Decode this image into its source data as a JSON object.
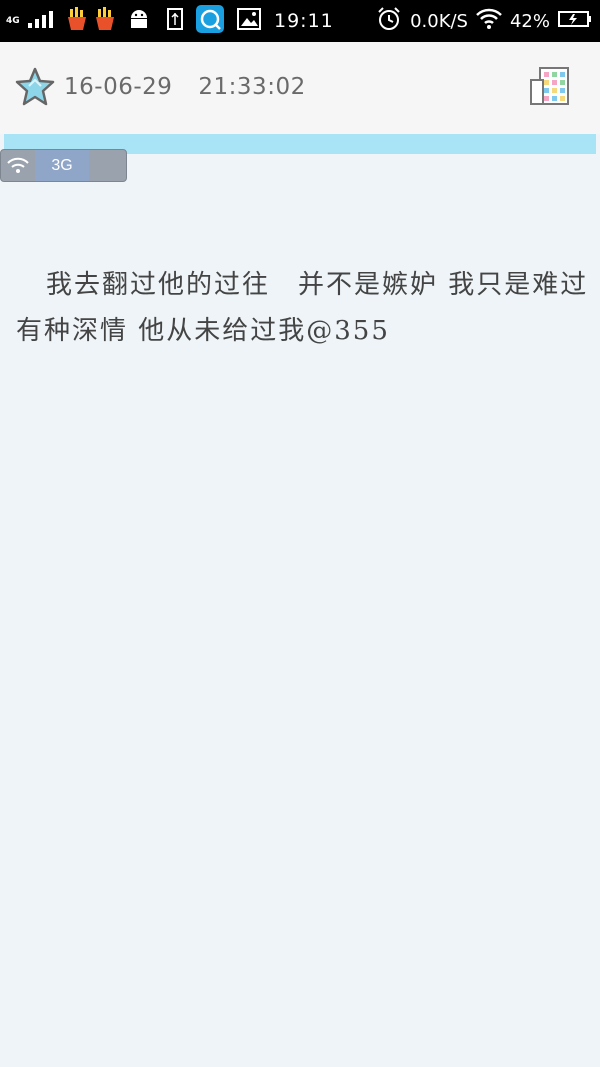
{
  "status_bar": {
    "network_type": "4G",
    "time": "19:11",
    "speed": "0.0K/S",
    "battery": "42%",
    "icons": [
      "signal-icon",
      "fries-icon",
      "fries-icon",
      "android-icon",
      "usb-icon",
      "browser-app-icon",
      "image-icon",
      "alarm-icon",
      "wifi-icon",
      "battery-icon"
    ]
  },
  "header": {
    "date": "16-06-29",
    "time": "21:33:02",
    "star_color": "#7fd0e8",
    "grid_colors": [
      "#f4a6c4",
      "#8fd6a0",
      "#7fc9ee",
      "#f6d97a"
    ]
  },
  "network_chip": {
    "label": "3G"
  },
  "note": {
    "text": "我去翻过他的过往　并不是嫉妒 我只是难过 有种深情 他从未给过我@355"
  }
}
